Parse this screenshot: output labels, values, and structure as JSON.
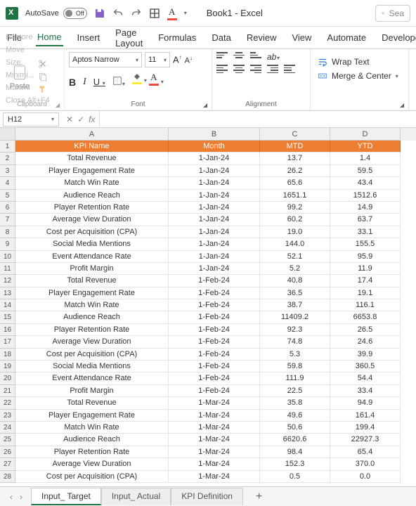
{
  "titlebar": {
    "autosave_label": "AutoSave",
    "autosave_state": "Off",
    "doc_title": "Book1 - Excel",
    "search_placeholder": "Sea"
  },
  "tabs": [
    "File",
    "Home",
    "Insert",
    "Page Layout",
    "Formulas",
    "Data",
    "Review",
    "View",
    "Automate",
    "Developer"
  ],
  "active_tab": "Home",
  "ghost_menu": [
    "Restore",
    "Move",
    "Size",
    "Minimi...",
    "Maximi",
    "Close        Alt+F4"
  ],
  "ribbon": {
    "clipboard": {
      "paste": "Paste",
      "label": "Clipboard"
    },
    "font": {
      "name": "Aptos Narrow",
      "size": "11",
      "label": "Font"
    },
    "alignment": {
      "label": "Alignment",
      "wrap": "Wrap Text",
      "merge": "Merge & Center"
    }
  },
  "formula_bar": {
    "name_box": "H12",
    "fx": "fx"
  },
  "columns": [
    "A",
    "B",
    "C",
    "D"
  ],
  "header_row": [
    "KPI Name",
    "Month",
    "MTD",
    "YTD"
  ],
  "rows": [
    [
      "Total Revenue",
      "1-Jan-24",
      "13.7",
      "1.4"
    ],
    [
      "Player Engagement Rate",
      "1-Jan-24",
      "26.2",
      "59.5"
    ],
    [
      "Match Win Rate",
      "1-Jan-24",
      "65.6",
      "43.4"
    ],
    [
      "Audience Reach",
      "1-Jan-24",
      "1651.1",
      "1512.6"
    ],
    [
      "Player Retention Rate",
      "1-Jan-24",
      "99.2",
      "14.9"
    ],
    [
      "Average View Duration",
      "1-Jan-24",
      "60.2",
      "63.7"
    ],
    [
      "Cost per Acquisition (CPA)",
      "1-Jan-24",
      "19.0",
      "33.1"
    ],
    [
      "Social Media Mentions",
      "1-Jan-24",
      "144.0",
      "155.5"
    ],
    [
      "Event Attendance Rate",
      "1-Jan-24",
      "52.1",
      "95.9"
    ],
    [
      "Profit Margin",
      "1-Jan-24",
      "5.2",
      "11.9"
    ],
    [
      "Total Revenue",
      "1-Feb-24",
      "40.8",
      "17.4"
    ],
    [
      "Player Engagement Rate",
      "1-Feb-24",
      "36.5",
      "19.1"
    ],
    [
      "Match Win Rate",
      "1-Feb-24",
      "38.7",
      "116.1"
    ],
    [
      "Audience Reach",
      "1-Feb-24",
      "11409.2",
      "6653.8"
    ],
    [
      "Player Retention Rate",
      "1-Feb-24",
      "92.3",
      "26.5"
    ],
    [
      "Average View Duration",
      "1-Feb-24",
      "74.8",
      "24.6"
    ],
    [
      "Cost per Acquisition (CPA)",
      "1-Feb-24",
      "5.3",
      "39.9"
    ],
    [
      "Social Media Mentions",
      "1-Feb-24",
      "59.8",
      "360.5"
    ],
    [
      "Event Attendance Rate",
      "1-Feb-24",
      "111.9",
      "54.4"
    ],
    [
      "Profit Margin",
      "1-Feb-24",
      "22.5",
      "33.4"
    ],
    [
      "Total Revenue",
      "1-Mar-24",
      "35.8",
      "94.9"
    ],
    [
      "Player Engagement Rate",
      "1-Mar-24",
      "49.6",
      "161.4"
    ],
    [
      "Match Win Rate",
      "1-Mar-24",
      "50.6",
      "199.4"
    ],
    [
      "Audience Reach",
      "1-Mar-24",
      "6620.6",
      "22927.3"
    ],
    [
      "Player Retention Rate",
      "1-Mar-24",
      "98.4",
      "65.4"
    ],
    [
      "Average View Duration",
      "1-Mar-24",
      "152.3",
      "370.0"
    ],
    [
      "Cost per Acquisition (CPA)",
      "1-Mar-24",
      "0.5",
      "0.0"
    ]
  ],
  "sheet_tabs": [
    "Input_ Target",
    "Input_ Actual",
    "KPI Definition"
  ],
  "active_sheet": "Input_ Target"
}
